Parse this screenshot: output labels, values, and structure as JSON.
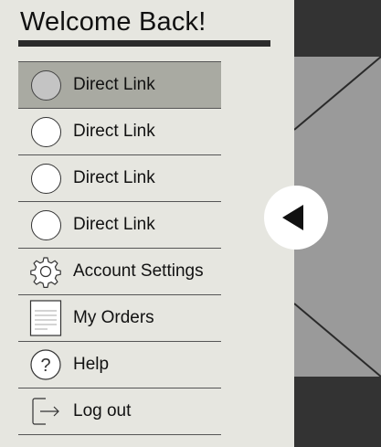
{
  "drawer": {
    "title": "Welcome Back!",
    "items": [
      {
        "label": "Direct Link",
        "icon": "circle-icon",
        "active": true
      },
      {
        "label": "Direct Link",
        "icon": "circle-icon",
        "active": false
      },
      {
        "label": "Direct Link",
        "icon": "circle-icon",
        "active": false
      },
      {
        "label": "Direct Link",
        "icon": "circle-icon",
        "active": false
      },
      {
        "label": "Account Settings",
        "icon": "gear-icon",
        "active": false
      },
      {
        "label": "My Orders",
        "icon": "document-icon",
        "active": false
      },
      {
        "label": "Help",
        "icon": "question-icon",
        "active": false
      },
      {
        "label": "Log out",
        "icon": "logout-icon",
        "active": false
      }
    ]
  },
  "toggle": {
    "icon": "triangle-left-icon"
  },
  "colors": {
    "drawer_bg": "#e6e6e0",
    "active_item_bg": "#a9aaa2",
    "page_dark": "#333333",
    "page_mid": "#9a9a9a"
  }
}
